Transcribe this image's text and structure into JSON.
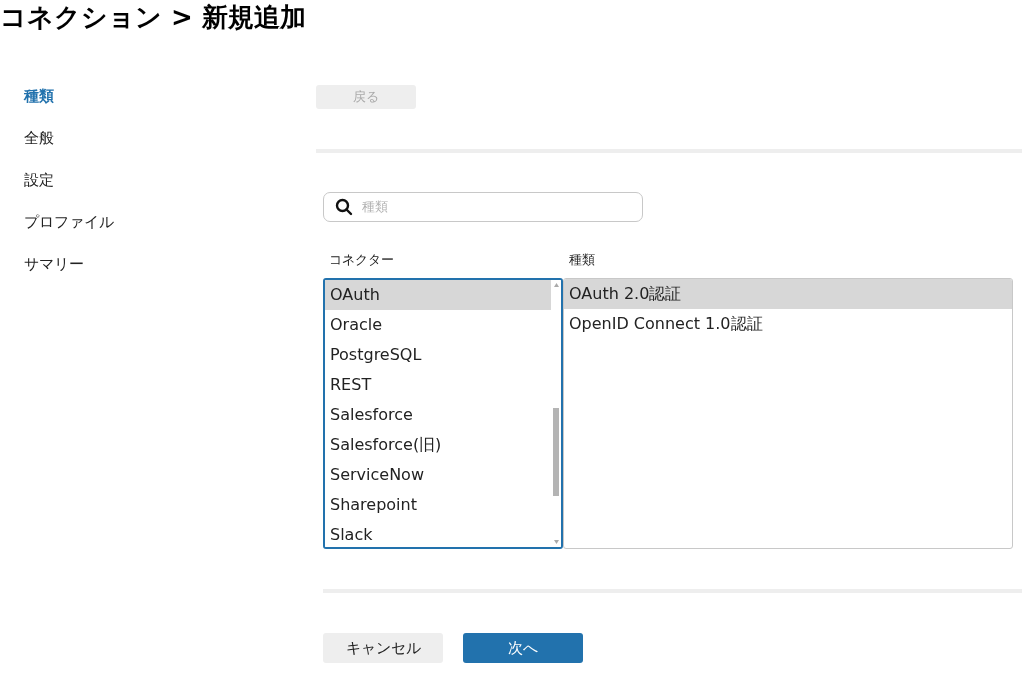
{
  "title": "コネクション > 新規追加",
  "sidebar": {
    "items": [
      {
        "label": "種類",
        "selected": true
      },
      {
        "label": "全般",
        "selected": false
      },
      {
        "label": "設定",
        "selected": false
      },
      {
        "label": "プロファイル",
        "selected": false
      },
      {
        "label": "サマリー",
        "selected": false
      }
    ]
  },
  "back_button": {
    "label": "戻る",
    "disabled": true
  },
  "search": {
    "placeholder": "種類"
  },
  "connectors": {
    "heading": "コネクター",
    "items": [
      {
        "label": "OAuth",
        "selected": true
      },
      {
        "label": "Oracle",
        "selected": false
      },
      {
        "label": "PostgreSQL",
        "selected": false
      },
      {
        "label": "REST",
        "selected": false
      },
      {
        "label": "Salesforce",
        "selected": false
      },
      {
        "label": "Salesforce(旧)",
        "selected": false
      },
      {
        "label": "ServiceNow",
        "selected": false
      },
      {
        "label": "Sharepoint",
        "selected": false
      },
      {
        "label": "Slack",
        "selected": false
      }
    ]
  },
  "types": {
    "heading": "種類",
    "items": [
      {
        "label": "OAuth 2.0認証",
        "selected": true
      },
      {
        "label": "OpenID Connect 1.0認証",
        "selected": false
      }
    ]
  },
  "buttons": [
    {
      "label": "キャンセル",
      "kind": "secondary"
    },
    {
      "label": "次へ",
      "kind": "primary"
    }
  ]
}
